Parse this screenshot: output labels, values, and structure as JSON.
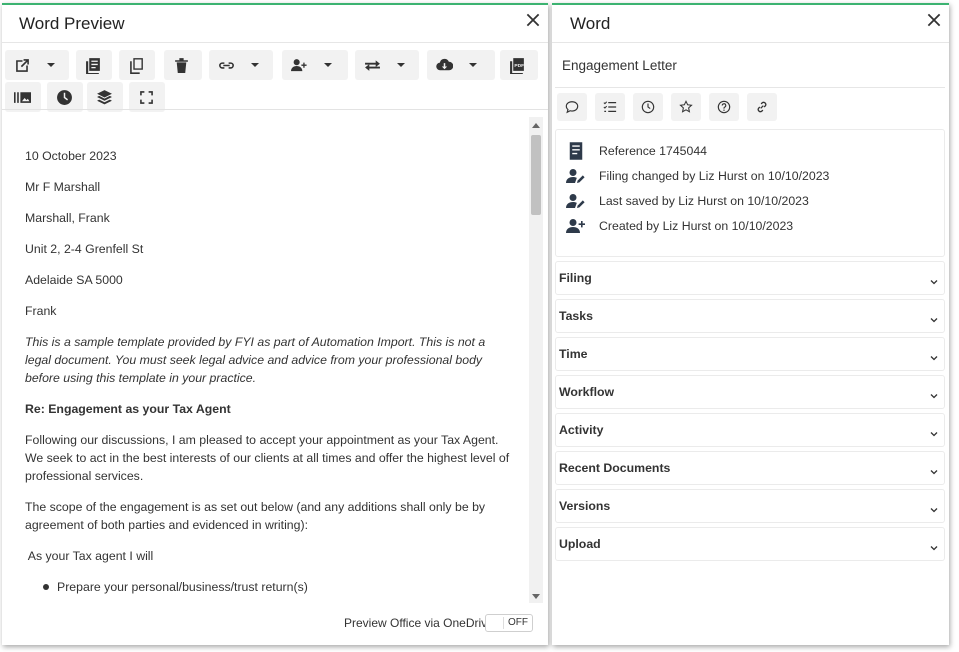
{
  "left_panel": {
    "title": "Word Preview",
    "toolbar_buttons": [
      {
        "name": "open-external",
        "icon": "external-link-icon",
        "has_dropdown": true
      },
      {
        "name": "copy-library",
        "icon": "library-copy-icon",
        "has_dropdown": false
      },
      {
        "name": "duplicate",
        "icon": "copy-icon",
        "has_dropdown": false
      },
      {
        "name": "delete",
        "icon": "trash-icon",
        "has_dropdown": false
      },
      {
        "name": "link",
        "icon": "link-icon",
        "has_dropdown": true
      },
      {
        "name": "add-user",
        "icon": "user-plus-icon",
        "has_dropdown": true
      },
      {
        "name": "transfer",
        "icon": "swap-arrows-icon",
        "has_dropdown": true
      },
      {
        "name": "cloud-download",
        "icon": "cloud-download-icon",
        "has_dropdown": true
      },
      {
        "name": "pdf",
        "icon": "pdf-icon",
        "has_dropdown": false
      },
      {
        "name": "gallery",
        "icon": "gallery-icon",
        "has_dropdown": false
      },
      {
        "name": "history",
        "icon": "clock-icon",
        "has_dropdown": false
      },
      {
        "name": "layers",
        "icon": "layers-icon",
        "has_dropdown": false
      },
      {
        "name": "fullscreen",
        "icon": "expand-icon",
        "has_dropdown": false
      }
    ],
    "document": {
      "date": "10 October 2023",
      "recipient": "Mr F Marshall",
      "name_line": "Marshall, Frank",
      "address1": "Unit 2, 2-4 Grenfell St",
      "address2": "Adelaide SA 5000",
      "salutation": "Frank",
      "disclaimer": "This is a sample template provided by FYI as part of Automation Import. This is not a legal document. You must seek legal advice and advice from your professional body before using this template in your practice.",
      "subject": "Re: Engagement as your Tax Agent",
      "para1": "Following our discussions, I am pleased to accept your appointment as your Tax Agent.  We seek to act in the best interests of our clients at all times and offer the highest level of professional services.",
      "para2": "The scope of the engagement is as set out below (and any additions shall only be by agreement of both parties and evidenced in writing):",
      "list_intro": " As your Tax agent I will",
      "bullets": [
        "Prepare your personal/business/trust return(s)"
      ]
    },
    "footer": {
      "label": "Preview Office via OneDrive",
      "toggle_text": "OFF"
    }
  },
  "right_panel": {
    "title": "Word",
    "document_name": "Engagement Letter",
    "action_icons": [
      "comment-icon",
      "task-list-icon",
      "clock-icon",
      "star-icon",
      "help-icon",
      "link-icon"
    ],
    "info": [
      {
        "icon": "document-icon",
        "text": "Reference 1745044"
      },
      {
        "icon": "user-edit-icon",
        "text": "Filing changed by Liz Hurst on 10/10/2023"
      },
      {
        "icon": "user-edit-icon",
        "text": "Last saved by Liz Hurst on 10/10/2023"
      },
      {
        "icon": "user-plus-icon",
        "text": "Created by Liz Hurst on 10/10/2023"
      }
    ],
    "sections": [
      "Filing",
      "Tasks",
      "Time",
      "Workflow",
      "Activity",
      "Recent Documents",
      "Versions",
      "Upload"
    ]
  },
  "colors": {
    "accent_border": "#3cb371",
    "button_bg": "#f2f2f2",
    "icon": "#2e3a4a"
  }
}
